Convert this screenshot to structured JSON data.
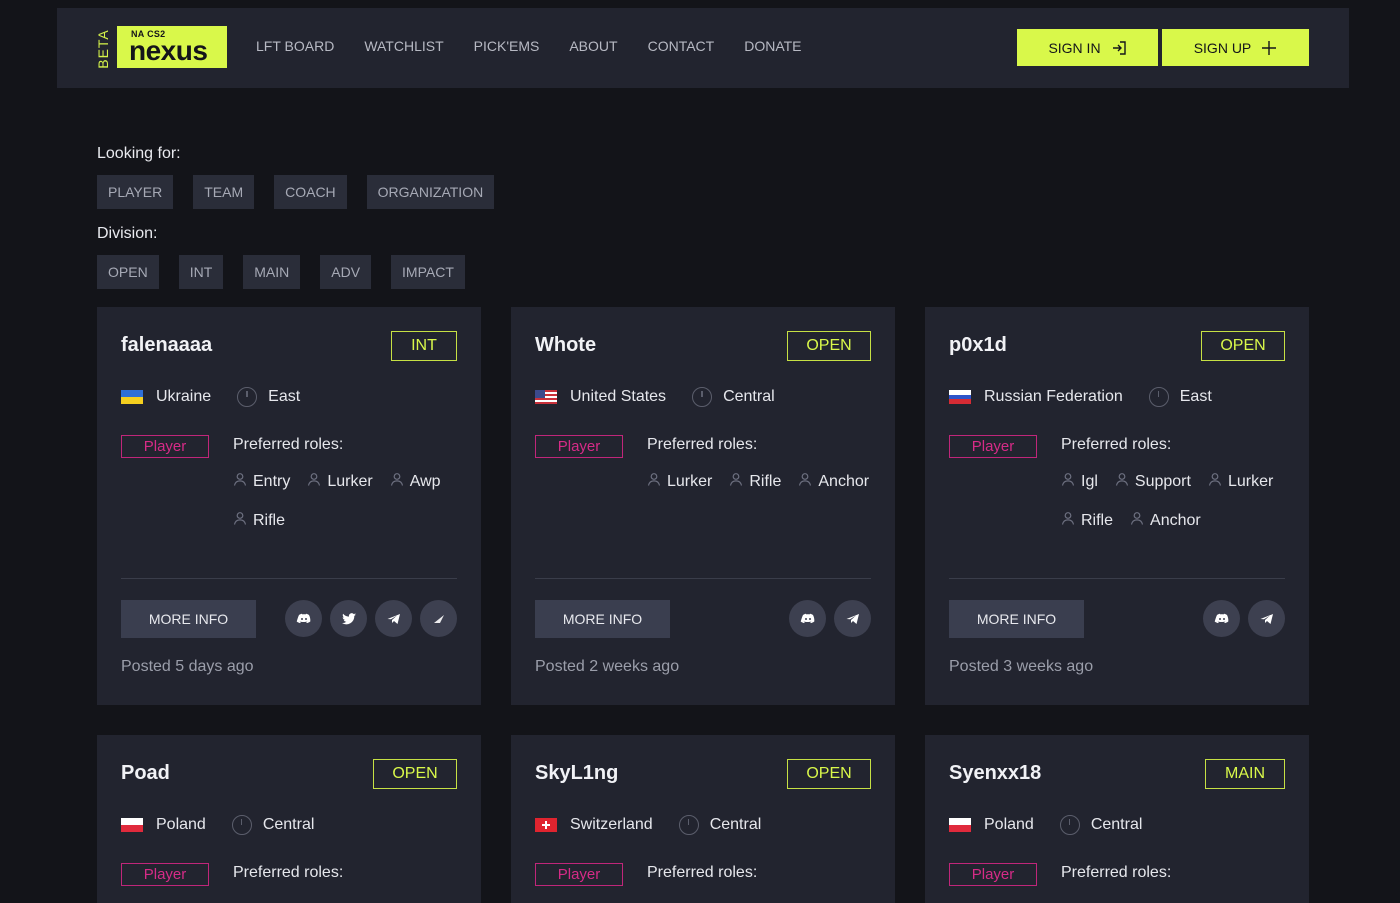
{
  "header": {
    "beta": "BETA",
    "logo_sub": "NA CS2",
    "logo_main": "nexus",
    "nav": [
      "LFT BOARD",
      "WATCHLIST",
      "PICK'EMS",
      "ABOUT",
      "CONTACT",
      "DONATE"
    ],
    "sign_in": "SIGN IN",
    "sign_up": "SIGN UP"
  },
  "filters": {
    "looking_for_label": "Looking for:",
    "looking_for": [
      "PLAYER",
      "TEAM",
      "COACH",
      "ORGANIZATION"
    ],
    "division_label": "Division:",
    "divisions": [
      "OPEN",
      "INT",
      "MAIN",
      "ADV",
      "IMPACT"
    ]
  },
  "colors": {
    "accent": "#d9f84a",
    "player": "#d62b87",
    "bg": "#131419",
    "card": "#22242f"
  },
  "cards": [
    {
      "name": "falenaaaa",
      "division": "INT",
      "country": "Ukraine",
      "flag": "ukraine",
      "region": "East",
      "type": "Player",
      "pref_label": "Preferred roles:",
      "roles": [
        "Entry",
        "Lurker",
        "Awp",
        "Rifle"
      ],
      "more": "MORE INFO",
      "socials": [
        "discord-icon",
        "twitter-icon",
        "telegram-icon",
        "faceit-icon"
      ],
      "posted": "Posted 5 days ago"
    },
    {
      "name": "Whote",
      "division": "OPEN",
      "country": "United States",
      "flag": "usa",
      "region": "Central",
      "type": "Player",
      "pref_label": "Preferred roles:",
      "roles": [
        "Lurker",
        "Rifle",
        "Anchor"
      ],
      "more": "MORE INFO",
      "socials": [
        "discord-icon",
        "telegram-icon"
      ],
      "posted": "Posted 2 weeks ago"
    },
    {
      "name": "p0x1d",
      "division": "OPEN",
      "country": "Russian Federation",
      "flag": "russia",
      "region": "East",
      "type": "Player",
      "pref_label": "Preferred roles:",
      "roles": [
        "Igl",
        "Support",
        "Lurker",
        "Rifle",
        "Anchor"
      ],
      "more": "MORE INFO",
      "socials": [
        "discord-icon",
        "telegram-icon"
      ],
      "posted": "Posted 3 weeks ago"
    },
    {
      "name": "Poad",
      "division": "OPEN",
      "country": "Poland",
      "flag": "poland",
      "region": "Central",
      "type": "Player",
      "pref_label": "Preferred roles:",
      "roles": [],
      "more": "",
      "socials": [],
      "posted": ""
    },
    {
      "name": "SkyL1ng",
      "division": "OPEN",
      "country": "Switzerland",
      "flag": "switzerland",
      "region": "Central",
      "type": "Player",
      "pref_label": "Preferred roles:",
      "roles": [],
      "more": "",
      "socials": [],
      "posted": ""
    },
    {
      "name": "Syenxx18",
      "division": "MAIN",
      "country": "Poland",
      "flag": "poland",
      "region": "Central",
      "type": "Player",
      "pref_label": "Preferred roles:",
      "roles": [],
      "more": "",
      "socials": [],
      "posted": ""
    }
  ]
}
